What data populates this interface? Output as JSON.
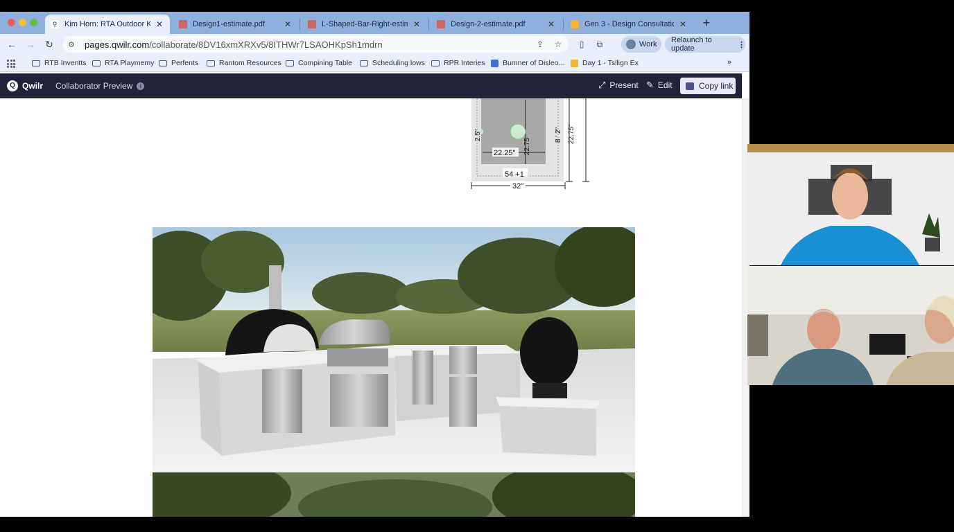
{
  "browser": {
    "tabs": [
      {
        "title": "Kim Horn: RTA Outdoor Kitch",
        "active": true
      },
      {
        "title": "Design1-estimate.pdf",
        "active": false
      },
      {
        "title": "L-Shaped-Bar-Right-estimat",
        "active": false
      },
      {
        "title": "Design-2-estimate.pdf",
        "active": false
      },
      {
        "title": "Gen 3 - Design Consultation",
        "active": false
      }
    ],
    "url_host": "pages.qwilr.com",
    "url_path": "/collaborate/8DV16xmXRXv5/8ITHWr7LSAOHKpSh1mdrn",
    "profile_label": "Work",
    "relaunch_label": "Relaunch to update",
    "bookmarks": [
      {
        "label": "RTB Inventts",
        "type": "folder"
      },
      {
        "label": "RTA Playmemy",
        "type": "folder"
      },
      {
        "label": "Perfents",
        "type": "folder"
      },
      {
        "label": "Rantom Resources",
        "type": "folder"
      },
      {
        "label": "Compining Table",
        "type": "folder"
      },
      {
        "label": "Scheduling lows",
        "type": "folder"
      },
      {
        "label": "RPR Interies",
        "type": "folder"
      },
      {
        "label": "Bumner of Disleo...",
        "type": "page"
      },
      {
        "label": "Day 1 - Tsllign Ex",
        "type": "page"
      }
    ]
  },
  "qwilr": {
    "brand": "Qwilr",
    "preview_label": "Collaborator Preview",
    "present_label": "Present",
    "edit_label": "Edit",
    "copy_link_label": "Copy link"
  },
  "drawing": {
    "dim_width_inner": "22.25\"",
    "dim_left_vertical": "2.5\"",
    "dim_inner_height": "22.75",
    "dim_right_small": "8 ' 2\"",
    "dim_right_tall": "22.75\"",
    "dim_bottom_label": "54 +1",
    "dim_total_width": "32\""
  },
  "colors": {
    "tabstrip": "#8fb0dc",
    "toolbar": "#e8eefa",
    "qwilr_bar": "#222338",
    "accent_blue": "#1a8fd3"
  }
}
